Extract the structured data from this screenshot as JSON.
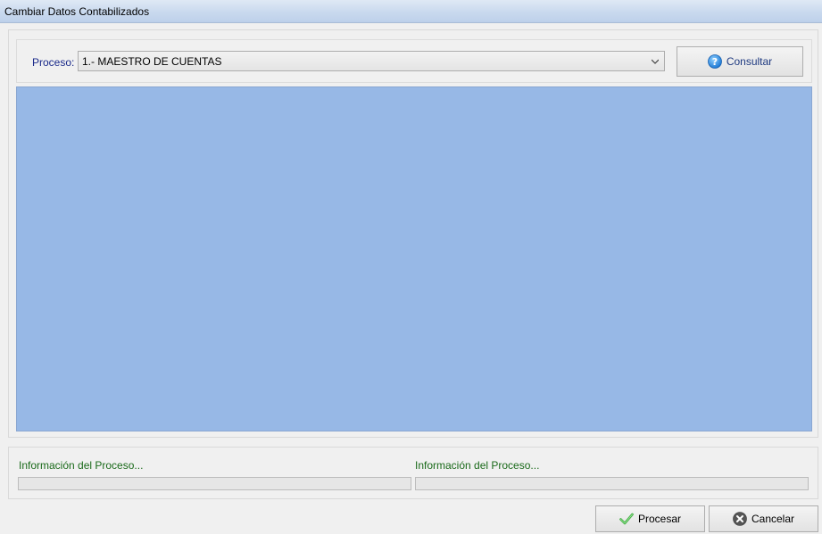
{
  "window": {
    "title": "Cambiar Datos Contabilizados"
  },
  "proceso": {
    "label": "Proceso:",
    "selected": "1.- MAESTRO DE CUENTAS"
  },
  "buttons": {
    "consultar": "Consultar",
    "procesar": "Procesar",
    "cancelar": "Cancelar"
  },
  "info": {
    "left_label": "Información del Proceso...",
    "right_label": "Información del Proceso...",
    "left_progress": 0,
    "right_progress": 0
  },
  "icons": {
    "consultar": "help-icon",
    "procesar": "checkmark-icon",
    "cancelar": "cancel-icon",
    "dropdown": "chevron-down-icon"
  },
  "colors": {
    "grid_background": "#97b8e6",
    "label_blue": "#1a2a8a",
    "label_green": "#1a6a1a"
  }
}
